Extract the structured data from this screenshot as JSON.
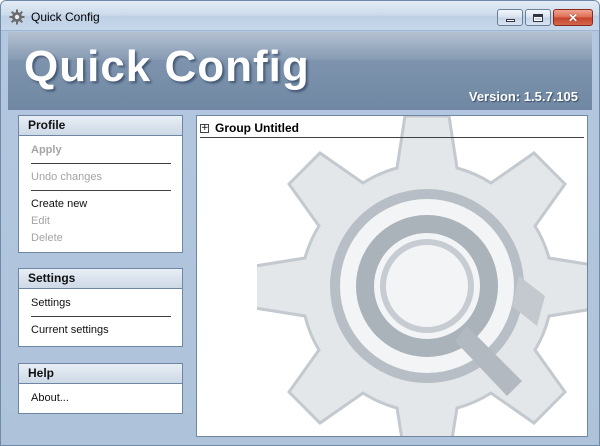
{
  "window": {
    "title": "Quick Config",
    "app_icon": "gear-icon"
  },
  "header": {
    "app_title": "Quick Config",
    "version": "Version: 1.5.7.105"
  },
  "profile": {
    "header": "Profile",
    "apply": "Apply",
    "undo": "Undo changes",
    "create_new": "Create new",
    "edit": "Edit",
    "delete": "Delete"
  },
  "settings": {
    "header": "Settings",
    "settings": "Settings",
    "current": "Current settings"
  },
  "help": {
    "header": "Help",
    "about": "About..."
  },
  "content": {
    "expander": "+",
    "group_title": "Group Untitled",
    "background_icon": "gear-magnifier-icon"
  },
  "colors": {
    "header_band": "#7d93ad",
    "panel_border": "#6f86a3",
    "disabled_text": "#a4a4a4",
    "close_button": "#c5412a"
  }
}
